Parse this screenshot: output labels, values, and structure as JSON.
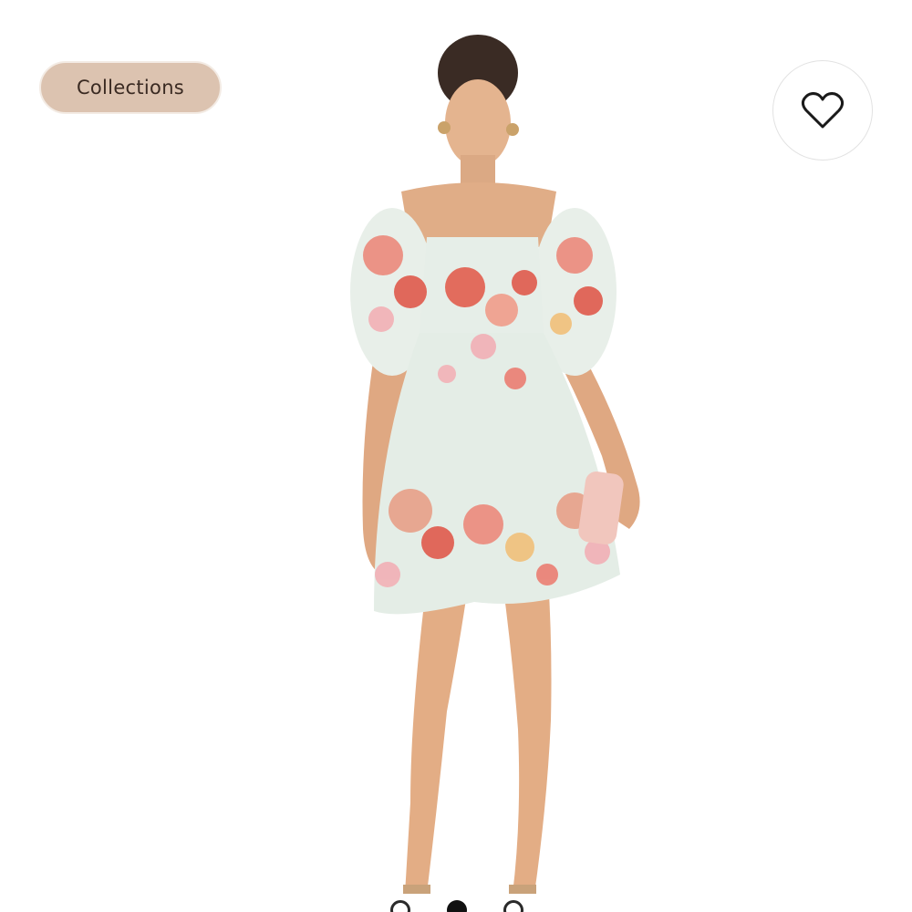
{
  "header": {
    "collections_label": "Collections"
  },
  "actions": {
    "like_icon": "heart-outline-icon"
  },
  "product_image": {
    "subject": "model-wearing-floral-puff-sleeve-mini-dress"
  },
  "carousel": {
    "total_dots": 3,
    "active_index": 1
  },
  "colors": {
    "chip_background": "#dcc3b0",
    "chip_text": "#3a2a22",
    "dot_color": "#111111"
  }
}
